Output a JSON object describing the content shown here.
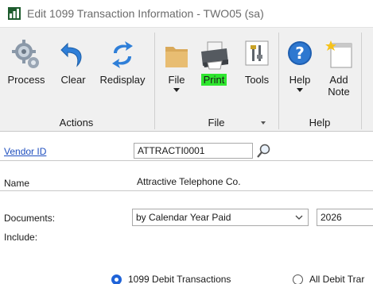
{
  "window": {
    "title": "Edit 1099 Transaction Information  -  TWO05 (sa)"
  },
  "ribbon": {
    "groups": [
      {
        "label": "Actions"
      },
      {
        "label": "File"
      },
      {
        "label": "Help"
      }
    ],
    "buttons": {
      "process": "Process",
      "clear": "Clear",
      "redisplay": "Redisplay",
      "file": "File",
      "print": "Print",
      "tools": "Tools",
      "help": "Help",
      "add_note_line1": "Add",
      "add_note_line2": "Note"
    },
    "print_highlight_color": "#2fe62f"
  },
  "form": {
    "vendor_id_label": "Vendor ID",
    "vendor_id_value": "ATTRACTI0001",
    "name_label": "Name",
    "name_value": "Attractive Telephone Co.",
    "documents_label": "Documents:",
    "documents_value": "by Calendar Year Paid",
    "year_value": "2026",
    "include_label": "Include:",
    "radio_debit_1099": "1099 Debit Transactions",
    "radio_all_debit": "All Debit Trar"
  },
  "colors": {
    "accent": "#1f63d8",
    "link": "#1f4fbf",
    "ribbon_bg": "#f0f0f0"
  }
}
